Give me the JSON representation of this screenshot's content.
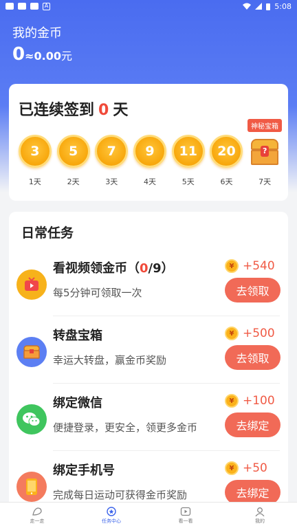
{
  "status_bar": {
    "time": "5:08"
  },
  "header": {
    "title": "我的金币",
    "coins": "0",
    "approx": "≈0.00",
    "unit": "元"
  },
  "checkin": {
    "prefix": "已连续签到",
    "days_count": "0",
    "suffix": "天",
    "mystery_badge": "神秘宝箱",
    "days": [
      {
        "value": "3",
        "label": "1天"
      },
      {
        "value": "5",
        "label": "2天"
      },
      {
        "value": "7",
        "label": "3天"
      },
      {
        "value": "9",
        "label": "4天"
      },
      {
        "value": "11",
        "label": "5天"
      },
      {
        "value": "20",
        "label": "6天"
      },
      {
        "value": "?",
        "label": "7天",
        "type": "chest"
      }
    ]
  },
  "tasks": {
    "title": "日常任务",
    "items": [
      {
        "name": "看视频领金币（",
        "progress_current": "0",
        "progress_total": "/9）",
        "desc": "每5分钟可领取一次",
        "reward": "+540",
        "button": "去领取",
        "icon": "tv-icon",
        "color": "#f7b21b"
      },
      {
        "name": "转盘宝箱",
        "desc": "幸运大转盘，赢金币奖励",
        "reward": "+500",
        "button": "去领取",
        "icon": "treasure-chest-icon",
        "color": "#5c7ff3"
      },
      {
        "name": "绑定微信",
        "desc": "便捷登录，更安全，领更多金币",
        "reward": "+100",
        "button": "去绑定",
        "icon": "wechat-icon",
        "color": "#3fc55e"
      },
      {
        "name": "绑定手机号",
        "desc": "完成每日运动可获得金币奖励",
        "reward": "+50",
        "button": "去绑定",
        "icon": "phone-icon",
        "color": "#f47b5e"
      }
    ]
  },
  "yen_symbol": "¥",
  "tabbar": [
    {
      "label": "走一走",
      "icon": "walk-icon",
      "active": false
    },
    {
      "label": "任务中心",
      "icon": "task-center-icon",
      "active": true
    },
    {
      "label": "看一看",
      "icon": "video-icon",
      "active": false
    },
    {
      "label": "我的",
      "icon": "profile-icon",
      "active": false
    }
  ],
  "colors": {
    "primary": "#4a6cf0",
    "accent": "#f16a57",
    "coin": "#f8a90f"
  }
}
